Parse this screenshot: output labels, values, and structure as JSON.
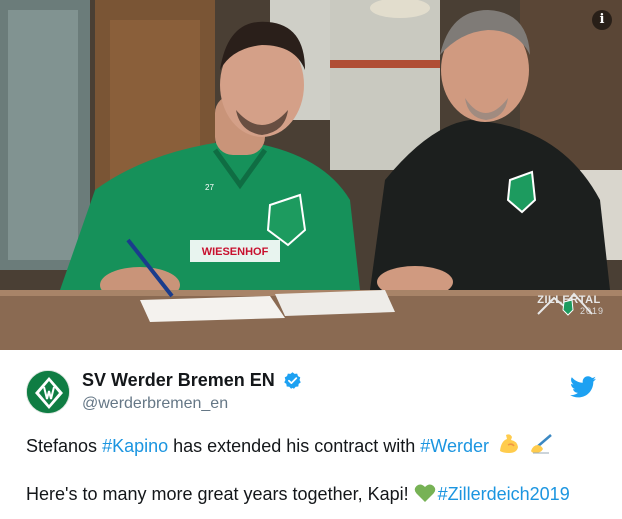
{
  "photo": {
    "info_icon": "i",
    "watermark_text": "ZILLERTAL",
    "watermark_year": "2019",
    "sponsor_text": "WIESENHOF",
    "shirt_number": "27",
    "colors": {
      "jersey_green": "#16915a",
      "jacket_black": "#1c1f1e",
      "crest_green": "#1d9b5f"
    }
  },
  "tweet": {
    "display_name": "SV Werder Bremen EN",
    "handle": "@werderbremen_en",
    "line1": {
      "t1": "Stefanos ",
      "h1": "#Kapino",
      "t2": " has extended his contract with ",
      "h2": "#Werder"
    },
    "line2": {
      "t1": "Here's to many more great years together, Kapi! ",
      "h1": "#Zillerdeich2019"
    },
    "icons": [
      "verified-icon",
      "twitter-bird-icon",
      "flexed-biceps-emoji",
      "writing-hand-emoji",
      "green-heart-emoji"
    ],
    "colors": {
      "hashtag": "#1b95e0",
      "handle": "#657786",
      "verified": "#1da1f2",
      "twitter": "#1da1f2"
    }
  }
}
